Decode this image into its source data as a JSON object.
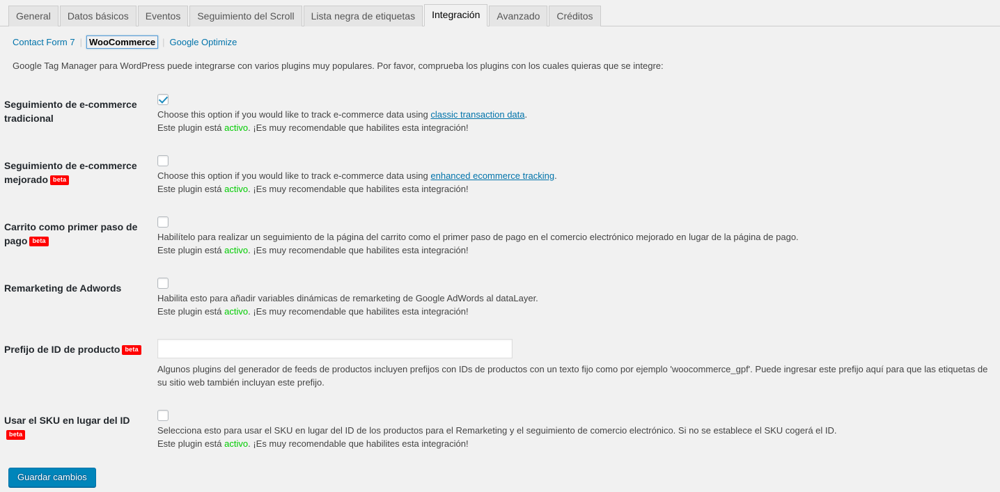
{
  "tabs": [
    {
      "label": "General",
      "active": false
    },
    {
      "label": "Datos básicos",
      "active": false
    },
    {
      "label": "Eventos",
      "active": false
    },
    {
      "label": "Seguimiento del Scroll",
      "active": false
    },
    {
      "label": "Lista negra de etiquetas",
      "active": false
    },
    {
      "label": "Integración",
      "active": true
    },
    {
      "label": "Avanzado",
      "active": false
    },
    {
      "label": "Créditos",
      "active": false
    }
  ],
  "subnav": {
    "items": [
      {
        "label": "Contact Form 7",
        "current": false
      },
      {
        "label": "WooCommerce",
        "current": true
      },
      {
        "label": "Google Optimize",
        "current": false
      }
    ],
    "separator": "|"
  },
  "intro": "Google Tag Manager para WordPress puede integrarse con varios plugins muy populares. Por favor, comprueba los plugins con los cuales quieras que se integre:",
  "beta_badge": "beta",
  "status_prefix": "Este plugin está ",
  "status_active": "activo",
  "status_suffix": ". ¡Es muy recomendable que habilites esta integración!",
  "rows": [
    {
      "label": "Seguimiento de e-commerce tradicional",
      "beta": false,
      "checked": true,
      "desc_before": "Choose this option if you would like to track e-commerce data using ",
      "desc_link": "classic transaction data",
      "desc_after": ".",
      "has_status": true
    },
    {
      "label": "Seguimiento de e-commerce mejorado",
      "beta": true,
      "checked": false,
      "desc_before": "Choose this option if you would like to track e-commerce data using ",
      "desc_link": "enhanced ecommerce tracking",
      "desc_after": ".",
      "has_status": true
    },
    {
      "label": "Carrito como primer paso de pago",
      "beta": true,
      "checked": false,
      "desc_before": "Habilítelo para realizar un seguimiento de la página del carrito como el primer paso de pago en el comercio electrónico mejorado en lugar de la página de pago.",
      "desc_link": "",
      "desc_after": "",
      "has_status": true
    },
    {
      "label": "Remarketing de Adwords",
      "beta": false,
      "checked": false,
      "desc_before": "Habilita esto para añadir variables dinámicas de remarketing de Google AdWords al dataLayer.",
      "desc_link": "",
      "desc_after": "",
      "has_status": true
    }
  ],
  "prefix_row": {
    "label": "Prefijo de ID de producto",
    "beta": true,
    "value": "",
    "placeholder": "",
    "desc": "Algunos plugins del generador de feeds de productos incluyen prefijos con IDs de productos con un texto fijo como por ejemplo 'woocommerce_gpf'. Puede ingresar este prefijo aquí para que las etiquetas de su sitio web también incluyan este prefijo."
  },
  "sku_row": {
    "label": "Usar el SKU en lugar del ID",
    "beta": true,
    "checked": false,
    "desc": "Selecciona esto para usar el SKU en lugar del ID de los productos para el Remarketing y el seguimiento de comercio electrónico. Si no se establece el SKU cogerá el ID.",
    "has_status": true
  },
  "submit": {
    "label": "Guardar cambios"
  },
  "colors": {
    "accent": "#0085ba",
    "link": "#0073aa",
    "active_green": "#00cc00",
    "beta_red": "#ff0000",
    "page_bg": "#f1f1f1"
  }
}
